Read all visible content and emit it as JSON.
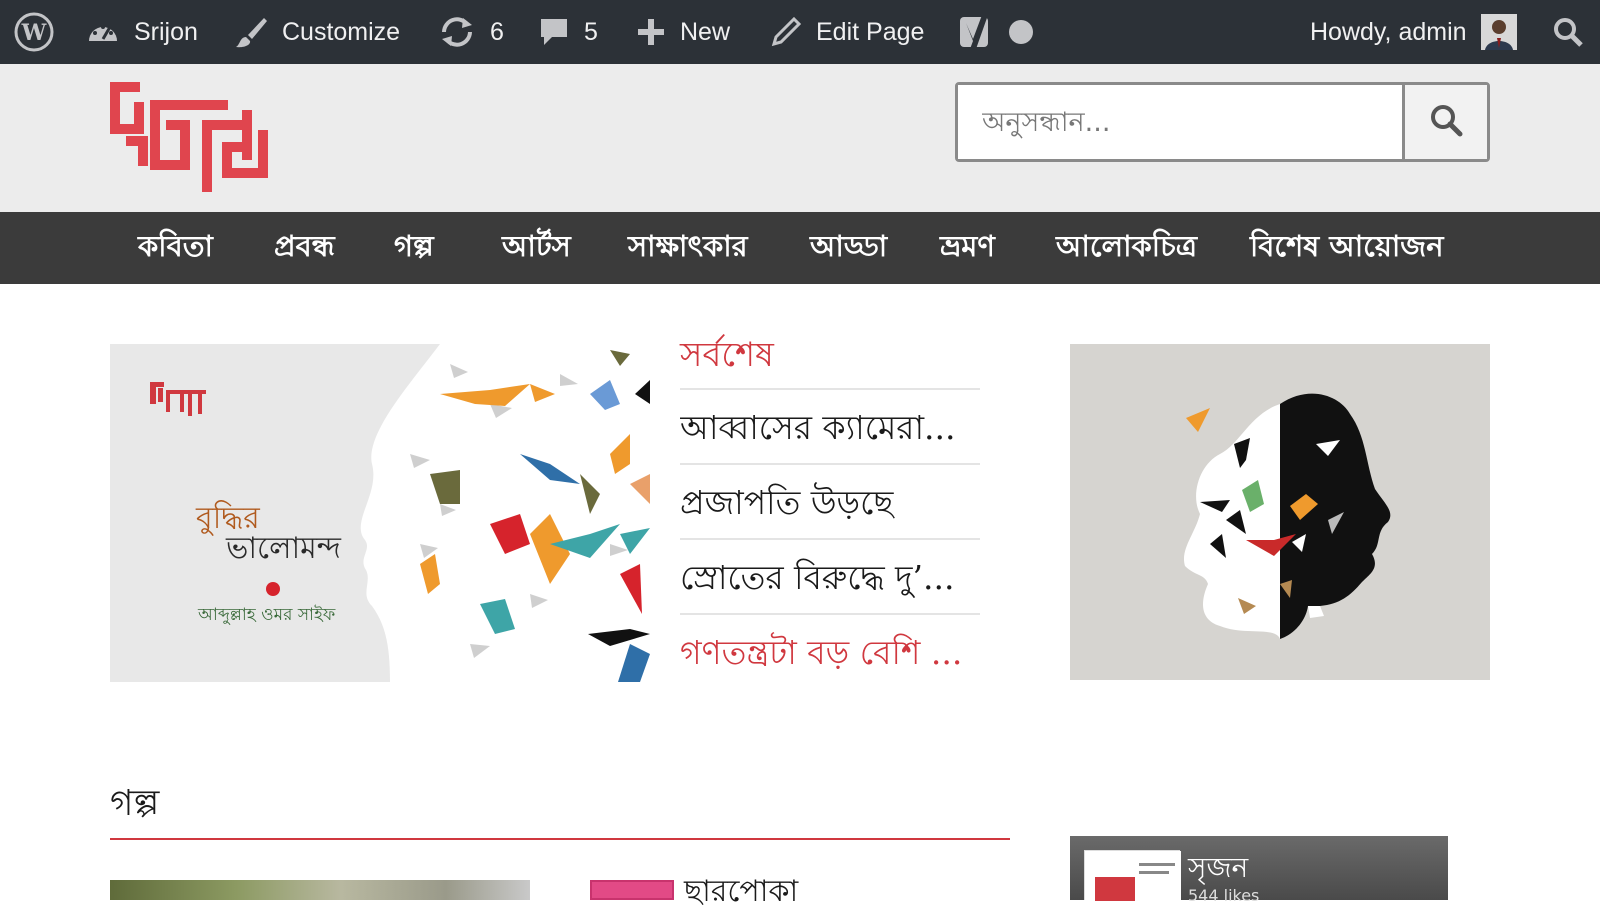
{
  "admin_bar": {
    "site_name": "Srijon",
    "customize": "Customize",
    "updates_count": "6",
    "comments_count": "5",
    "new_label": "New",
    "edit_page": "Edit Page",
    "howdy": "Howdy, admin"
  },
  "header": {
    "logo_text": "সৃজন",
    "search_placeholder": "অনুসন্ধান..."
  },
  "nav": {
    "items": [
      "কবিতা",
      "প্রবন্ধ",
      "গল্প",
      "আর্টস",
      "সাক্ষাৎকার",
      "আড্ডা",
      "ভ্রমণ",
      "আলোকচিত্র",
      "বিশেষ আয়োজন"
    ]
  },
  "featured": {
    "image_logo_text": "সৃজন",
    "image_title_1": "বুদ্ধির",
    "image_title_2": "ভালোমন্দ",
    "image_author": "আব্দুল্লাহ ওমর সাইফ"
  },
  "latest": {
    "title": "সর্বশেষ",
    "items": [
      "আব্বাসের ক্যামেরা...",
      "প্রজাপতি উড়ছে",
      "স্রোতের বিরুদ্ধে দু’...",
      "গণতন্ত্রটা বড় বেশি ..."
    ]
  },
  "section": {
    "title": "গল্প",
    "story_title": "ছারপোকা"
  },
  "facebook_widget": {
    "name": "সৃজন",
    "likes": "544 likes"
  },
  "colors": {
    "accent_red": "#d0383f",
    "admin_bar": "#2c3137",
    "nav_bg": "#3b3b3b",
    "header_bg": "#ececec"
  }
}
